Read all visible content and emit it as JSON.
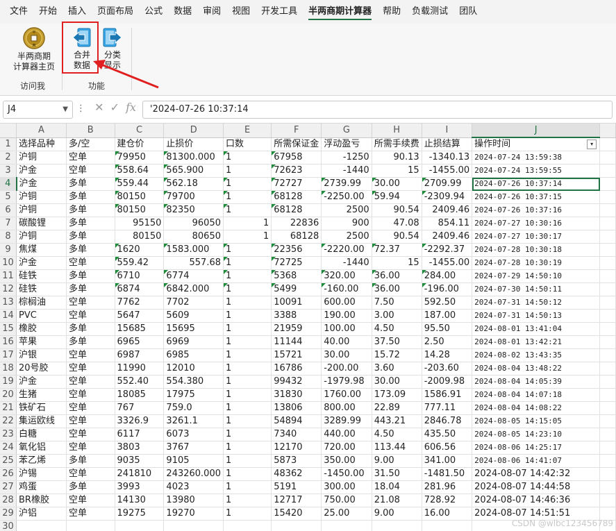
{
  "tabs": [
    "文件",
    "开始",
    "插入",
    "页面布局",
    "公式",
    "数据",
    "审阅",
    "视图",
    "开发工具",
    "半两商期计算器",
    "帮助",
    "负载测试",
    "团队"
  ],
  "active_tab": "半两商期计算器",
  "ribbon": {
    "home_btn": {
      "line1": "半两商期",
      "line2": "计算器主页"
    },
    "merge_btn": {
      "line1": "合并",
      "line2": "数据"
    },
    "classify_btn": {
      "line1": "分类",
      "line2": "显示"
    },
    "group1": "访问我",
    "group2": "功能"
  },
  "formula_bar": {
    "name_box": "J4",
    "formula": "'2024-07-26 10:37:14"
  },
  "columns": [
    "A",
    "B",
    "C",
    "D",
    "E",
    "F",
    "G",
    "H",
    "I",
    "J"
  ],
  "header_row": [
    "选择品种",
    "多/空",
    "建仓价",
    "止损价",
    "口数",
    "所需保证金",
    "浮动盈亏",
    "所需手续费",
    "止损结算",
    "操作时间"
  ],
  "rows": [
    [
      "沪铜",
      "空单",
      "79950",
      "81300.000",
      "1",
      "67958",
      "-1250",
      "90.13",
      "-1340.13",
      "2024-07-24 13:59:38"
    ],
    [
      "沪金",
      "空单",
      "558.64",
      "565.900",
      "1",
      "72623",
      "-1440",
      "15",
      "-1455.00",
      "2024-07-24 13:59:55"
    ],
    [
      "沪金",
      "多单",
      "559.44",
      "562.18",
      "1",
      "72727",
      "2739.99",
      "30.00",
      "2709.99",
      "2024-07-26 10:37:14"
    ],
    [
      "沪铜",
      "多单",
      "80150",
      "79700",
      "1",
      "68128",
      "-2250.00",
      "59.94",
      "-2309.94",
      "2024-07-26 10:37:15"
    ],
    [
      "沪铜",
      "多单",
      "80150",
      "82350",
      "1",
      "68128",
      "2500",
      "90.54",
      "2409.46",
      "2024-07-26 10:37:16"
    ],
    [
      "碳酸锂",
      "多单",
      "95150",
      "96050",
      "1",
      "22836",
      "900",
      "47.08",
      "854.11",
      "2024-07-27 10:30:16"
    ],
    [
      "沪铜",
      "多单",
      "80150",
      "80650",
      "1",
      "68128",
      "2500",
      "90.54",
      "2409.46",
      "2024-07-27 10:30:17"
    ],
    [
      "焦煤",
      "多单",
      "1620",
      "1583.000",
      "1",
      "22356",
      "-2220.00",
      "72.37",
      "-2292.37",
      "2024-07-28 10:30:18"
    ],
    [
      "沪金",
      "空单",
      "559.42",
      "557.68",
      "1",
      "72725",
      "-1440",
      "15",
      "-1455.00",
      "2024-07-28 10:30:19"
    ],
    [
      "硅铁",
      "多单",
      "6710",
      "6774",
      "1",
      "5368",
      "320.00",
      "36.00",
      "284.00",
      "2024-07-29 14:50:10"
    ],
    [
      "硅铁",
      "多单",
      "6874",
      "6842.000",
      "1",
      "5499",
      "-160.00",
      "36.00",
      "-196.00",
      "2024-07-30 14:50:11"
    ],
    [
      "棕榈油",
      "空单",
      "7762",
      "7702",
      "1",
      "10091",
      "600.00",
      "7.50",
      "592.50",
      "2024-07-31 14:50:12"
    ],
    [
      "PVC",
      "空单",
      "5647",
      "5609",
      "1",
      "3388",
      "190.00",
      "3.00",
      "187.00",
      "2024-07-31 14:50:13"
    ],
    [
      "橡胶",
      "多单",
      "15685",
      "15695",
      "1",
      "21959",
      "100.00",
      "4.50",
      "95.50",
      "2024-08-01 13:41:04"
    ],
    [
      "苹果",
      "多单",
      "6965",
      "6969",
      "1",
      "11144",
      "40.00",
      "37.50",
      "2.50",
      "2024-08-01 13:42:21"
    ],
    [
      "沪银",
      "空单",
      "6987",
      "6985",
      "1",
      "15721",
      "30.00",
      "15.72",
      "14.28",
      "2024-08-02 13:43:35"
    ],
    [
      "20号胶",
      "空单",
      "11990",
      "12010",
      "1",
      "16786",
      "-200.00",
      "3.60",
      "-203.60",
      "2024-08-04 13:48:22"
    ],
    [
      "沪金",
      "空单",
      "552.40",
      "554.380",
      "1",
      "99432",
      "-1979.98",
      "30.00",
      "-2009.98",
      "2024-08-04 14:05:39"
    ],
    [
      "生猪",
      "空单",
      "18085",
      "17975",
      "1",
      "31830",
      "1760.00",
      "173.09",
      "1586.91",
      "2024-08-04 14:07:18"
    ],
    [
      "铁矿石",
      "空单",
      "767",
      "759.0",
      "1",
      "13806",
      "800.00",
      "22.89",
      "777.11",
      "2024-08-04 14:08:22"
    ],
    [
      "集运欧线",
      "空单",
      "3326.9",
      "3261.1",
      "1",
      "54894",
      "3289.99",
      "443.21",
      "2846.78",
      "2024-08-05 14:15:05"
    ],
    [
      "白糖",
      "空单",
      "6117",
      "6073",
      "1",
      "7340",
      "440.00",
      "4.50",
      "435.50",
      "2024-08-05 14:23:10"
    ],
    [
      "氧化铝",
      "空单",
      "3803",
      "3767",
      "1",
      "12170",
      "720.00",
      "113.44",
      "606.56",
      "2024-08-06 14:25:17"
    ],
    [
      "苯乙烯",
      "多单",
      "9035",
      "9105",
      "1",
      "5873",
      "350.00",
      "9.00",
      "341.00",
      "2024-08-06 14:41:07"
    ],
    [
      "沪锡",
      "空单",
      "241810",
      "243260.000",
      "1",
      "48362",
      "-1450.00",
      "31.50",
      "-1481.50",
      "2024-08-07 14:42:32"
    ],
    [
      "鸡蛋",
      "多单",
      "3993",
      "4023",
      "1",
      "5191",
      "300.00",
      "18.04",
      "281.96",
      "2024-08-07 14:44:58"
    ],
    [
      "BR橡胶",
      "空单",
      "14130",
      "13980",
      "1",
      "12717",
      "750.00",
      "21.08",
      "728.92",
      "2024-08-07 14:46:36"
    ],
    [
      "沪铝",
      "空单",
      "19275",
      "19270",
      "1",
      "15420",
      "25.00",
      "9.00",
      "16.00",
      "2024-08-07 14:51:51"
    ]
  ],
  "watermark": "CSDN @wlbc123456789"
}
